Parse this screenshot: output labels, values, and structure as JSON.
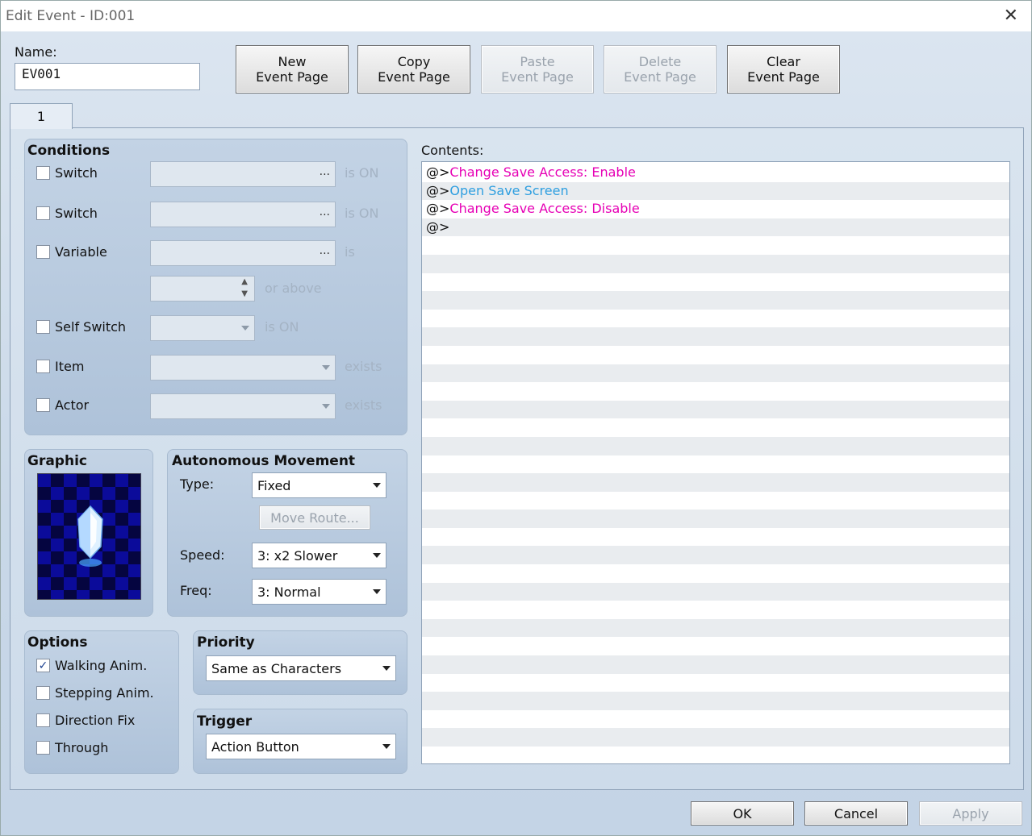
{
  "window": {
    "title": "Edit Event - ID:001"
  },
  "name": {
    "label": "Name:",
    "value": "EV001"
  },
  "toolbar": {
    "new_l1": "New",
    "new_l2": "Event Page",
    "copy_l1": "Copy",
    "copy_l2": "Event Page",
    "paste_l1": "Paste",
    "paste_l2": "Event Page",
    "delete_l1": "Delete",
    "delete_l2": "Event Page",
    "clear_l1": "Clear",
    "clear_l2": "Event Page"
  },
  "tabs": [
    {
      "label": "1"
    }
  ],
  "conditions": {
    "title": "Conditions",
    "switch1": {
      "label": "Switch",
      "suffix": "is ON",
      "ellipsis": "..."
    },
    "switch2": {
      "label": "Switch",
      "suffix": "is ON",
      "ellipsis": "..."
    },
    "variable": {
      "label": "Variable",
      "suffix": "is",
      "ellipsis": "...",
      "or_above": "or above"
    },
    "self_switch": {
      "label": "Self Switch",
      "suffix": "is ON"
    },
    "item": {
      "label": "Item",
      "suffix": "exists"
    },
    "actor": {
      "label": "Actor",
      "suffix": "exists"
    }
  },
  "graphic": {
    "title": "Graphic"
  },
  "movement": {
    "title": "Autonomous Movement",
    "type_label": "Type:",
    "type_value": "Fixed",
    "move_route": "Move Route...",
    "speed_label": "Speed:",
    "speed_value": "3: x2 Slower",
    "freq_label": "Freq:",
    "freq_value": "3: Normal"
  },
  "options": {
    "title": "Options",
    "walking": {
      "label": "Walking Anim.",
      "checked": true
    },
    "stepping": {
      "label": "Stepping Anim.",
      "checked": false
    },
    "direction_fix": {
      "label": "Direction Fix",
      "checked": false
    },
    "through": {
      "label": "Through",
      "checked": false
    }
  },
  "priority": {
    "title": "Priority",
    "value": "Same as Characters"
  },
  "trigger": {
    "title": "Trigger",
    "value": "Action Button"
  },
  "contents": {
    "label": "Contents:",
    "lines": [
      {
        "prefix": "@>",
        "text": "Change Save Access: Enable",
        "color": "#e600b5"
      },
      {
        "prefix": "@>",
        "text": "Open Save Screen",
        "color": "#2f9fe0"
      },
      {
        "prefix": "@>",
        "text": "Change Save Access: Disable",
        "color": "#e600b5"
      },
      {
        "prefix": "@>",
        "text": ""
      }
    ]
  },
  "footer": {
    "ok": "OK",
    "cancel": "Cancel",
    "apply": "Apply"
  }
}
